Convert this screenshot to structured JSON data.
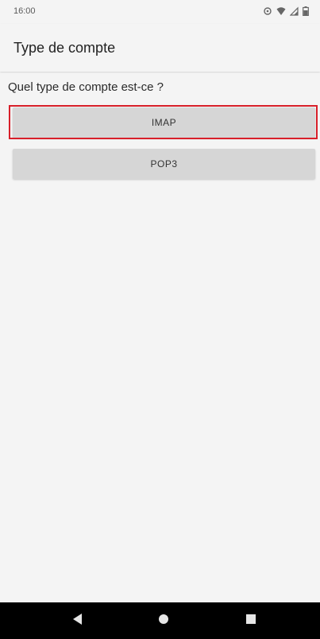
{
  "status_bar": {
    "time": "16:00",
    "icons": [
      "sync-icon",
      "wifi-icon",
      "signal-icon",
      "battery-icon"
    ]
  },
  "app_bar": {
    "title": "Type de compte"
  },
  "main": {
    "question": "Quel type de compte est-ce ?",
    "options": [
      {
        "label": "IMAP",
        "highlighted": true
      },
      {
        "label": "POP3",
        "highlighted": false
      }
    ]
  },
  "nav_bar": {
    "buttons": [
      "back-icon",
      "home-icon",
      "recents-icon"
    ]
  },
  "colors": {
    "background": "#f4f4f4",
    "button": "#d6d6d6",
    "highlight": "#d8202a",
    "nav_bar": "#000000"
  }
}
